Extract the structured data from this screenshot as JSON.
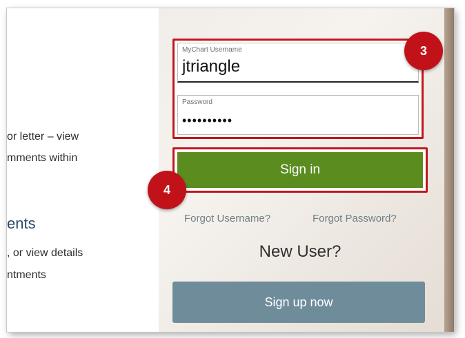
{
  "left_panel": {
    "line1": "or letter – view",
    "line2": "mments within",
    "heading": "ents",
    "line3": ", or view details",
    "line4": "ntments"
  },
  "login": {
    "username_label": "MyChart Username",
    "username_value": "jtriangle",
    "password_label": "Password",
    "password_value": "••••••••••",
    "signin_label": "Sign in",
    "forgot_username": "Forgot Username?",
    "forgot_password": "Forgot Password?",
    "new_user_heading": "New User?",
    "signup_label": "Sign up now"
  },
  "annotations": {
    "step_3": "3",
    "step_4": "4"
  },
  "colors": {
    "highlight_red": "#c0161d",
    "signin_green": "#5a8c1f",
    "signup_slate": "#6f8c9b",
    "link_gray": "#6f7f86"
  }
}
